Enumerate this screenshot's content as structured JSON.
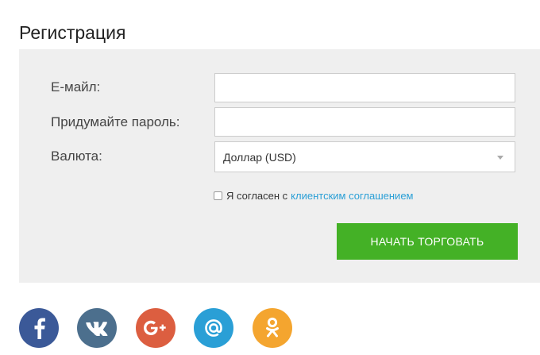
{
  "page": {
    "title": "Регистрация"
  },
  "form": {
    "email_label": "Е-майл:",
    "email_value": "",
    "password_label": "Придумайте пароль:",
    "password_value": "",
    "currency_label": "Валюта:",
    "currency_selected": "Доллар (USD)",
    "agree_text": "Я согласен с",
    "agree_link": "клиентским соглашением",
    "agree_checked": false,
    "submit_label": "НАЧАТЬ ТОРГОВАТЬ",
    "submit_color": "#44b126",
    "panel_color": "#efefef"
  },
  "social": [
    {
      "name": "facebook-icon",
      "color": "#3b5998",
      "glyph": "f"
    },
    {
      "name": "vk-icon",
      "color": "#4c6f8d",
      "glyph": "vk"
    },
    {
      "name": "google-plus-icon",
      "color": "#dc5e40",
      "glyph": "G+"
    },
    {
      "name": "mail-ru-icon",
      "color": "#2a9fd6",
      "glyph": "@"
    },
    {
      "name": "odnoklassniki-icon",
      "color": "#f4a52f",
      "glyph": "ok"
    }
  ]
}
